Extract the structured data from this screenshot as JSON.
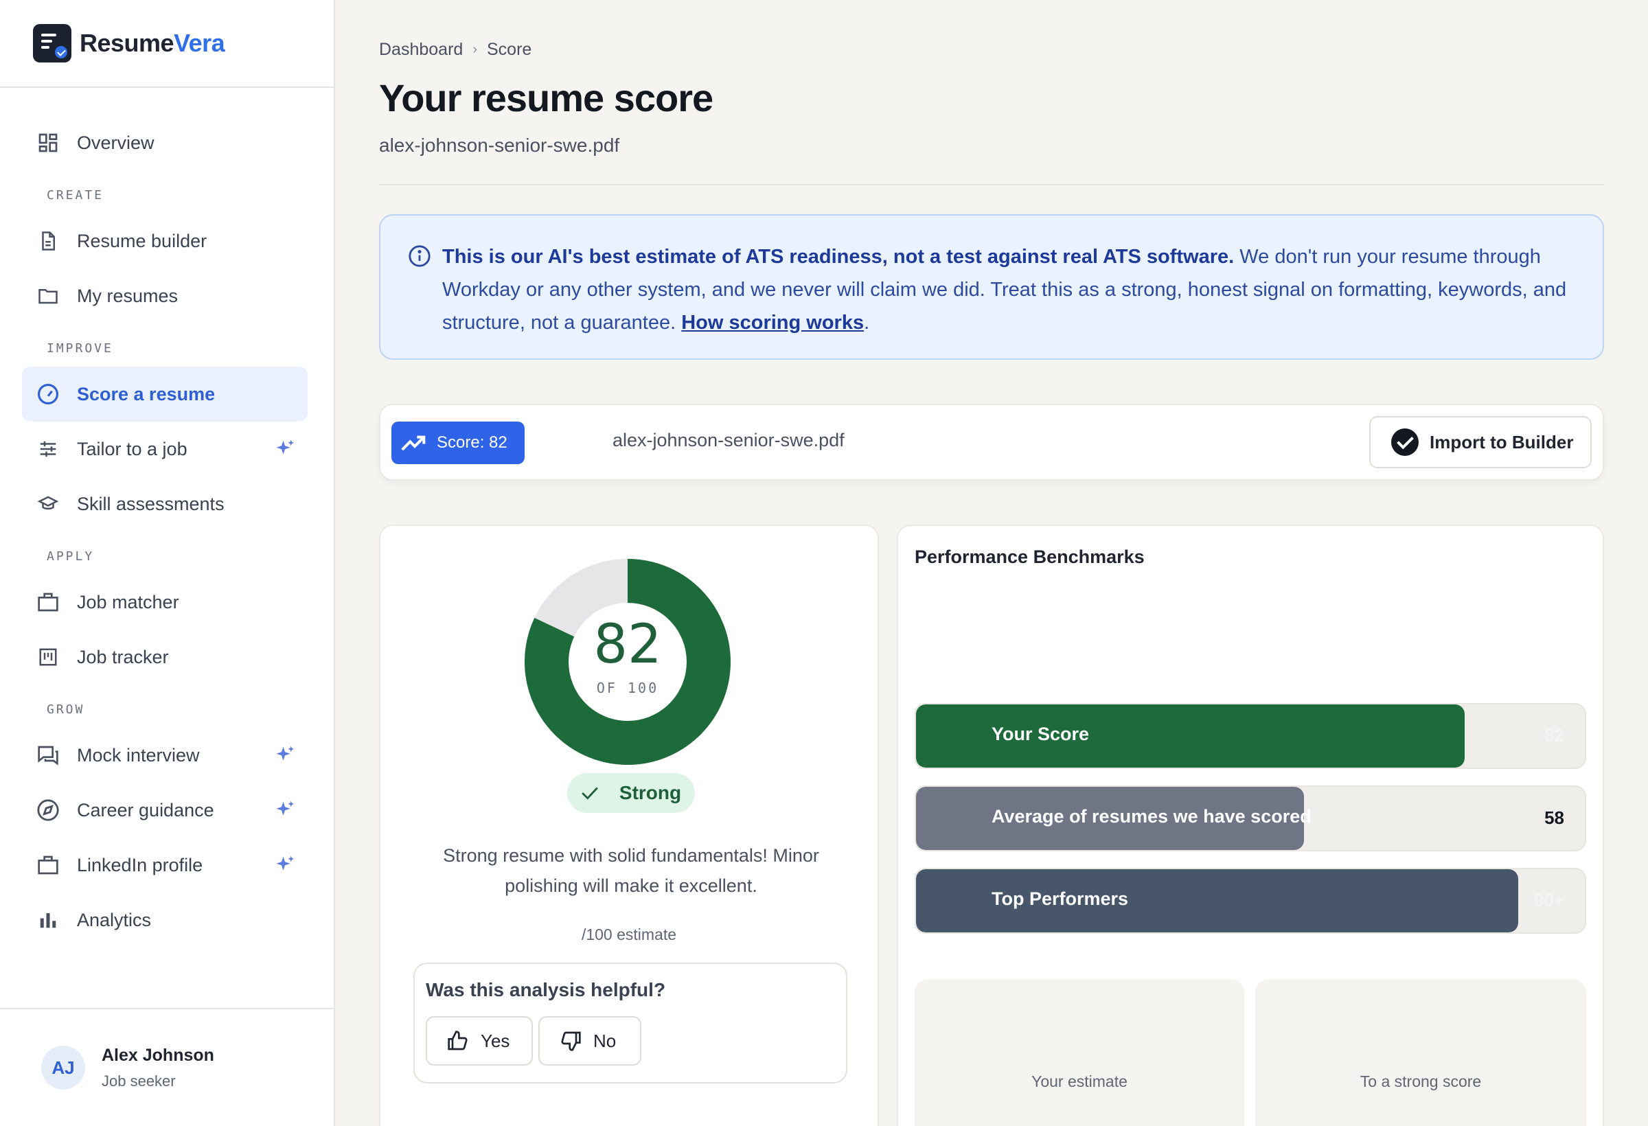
{
  "brand": {
    "name_a": "Resume",
    "name_b": "Vera",
    "accent": "#2f6fe8"
  },
  "sidebar": {
    "overview": "Overview",
    "sections": {
      "create": "CREATE",
      "improve": "IMPROVE",
      "apply": "APPLY",
      "grow": "GROW"
    },
    "items": {
      "resume_builder": "Resume builder",
      "my_resumes": "My resumes",
      "score_resume": "Score a resume",
      "tailor_job": "Tailor to a job",
      "skill_assessments": "Skill assessments",
      "job_matcher": "Job matcher",
      "job_tracker": "Job tracker",
      "mock_interview": "Mock interview",
      "career_guidance": "Career guidance",
      "linkedin_profile": "LinkedIn profile",
      "analytics": "Analytics"
    },
    "user": {
      "initials": "AJ",
      "name": "Alex Johnson",
      "role": "Job seeker"
    }
  },
  "header": {
    "breadcrumb": [
      "Dashboard",
      "Score"
    ],
    "title": "Your resume score",
    "file": "alex-johnson-senior-swe.pdf"
  },
  "notice": {
    "bold": "This is our AI's best estimate of ATS readiness, not a test against real ATS software.",
    "body": " We don't run your resume through Workday or any other system, and we never will claim we did. Treat this as a strong, honest signal on formatting, keywords, and structure, not a guarantee. ",
    "link": "How scoring works",
    "end": "."
  },
  "scorebar": {
    "pill": "Score: 82",
    "file": "alex-johnson-senior-swe.pdf",
    "import": "Import to Builder"
  },
  "score": {
    "value": "82",
    "out_of": "OF 100",
    "fraction": 0.82,
    "rating": "Strong",
    "summary": "Strong resume with solid fundamentals! Minor polishing will make it excellent.",
    "estimate": "/100 estimate",
    "color": "#1d6a3a"
  },
  "feedback": {
    "question": "Was this analysis helpful?",
    "yes": "Yes",
    "no": "No"
  },
  "benchmarks": {
    "title": "Performance Benchmarks",
    "bars": [
      {
        "label": "Your Score",
        "value": "82",
        "fraction": 0.82,
        "color": "#1d6a3a"
      },
      {
        "label": "Average of resumes we have scored",
        "value": "58",
        "fraction": 0.58,
        "color": "#6f7584"
      },
      {
        "label": "Top Performers",
        "value": "90+",
        "fraction": 0.9,
        "color": "#48566a"
      }
    ],
    "tiles": [
      "Your estimate",
      "To a strong score"
    ]
  }
}
